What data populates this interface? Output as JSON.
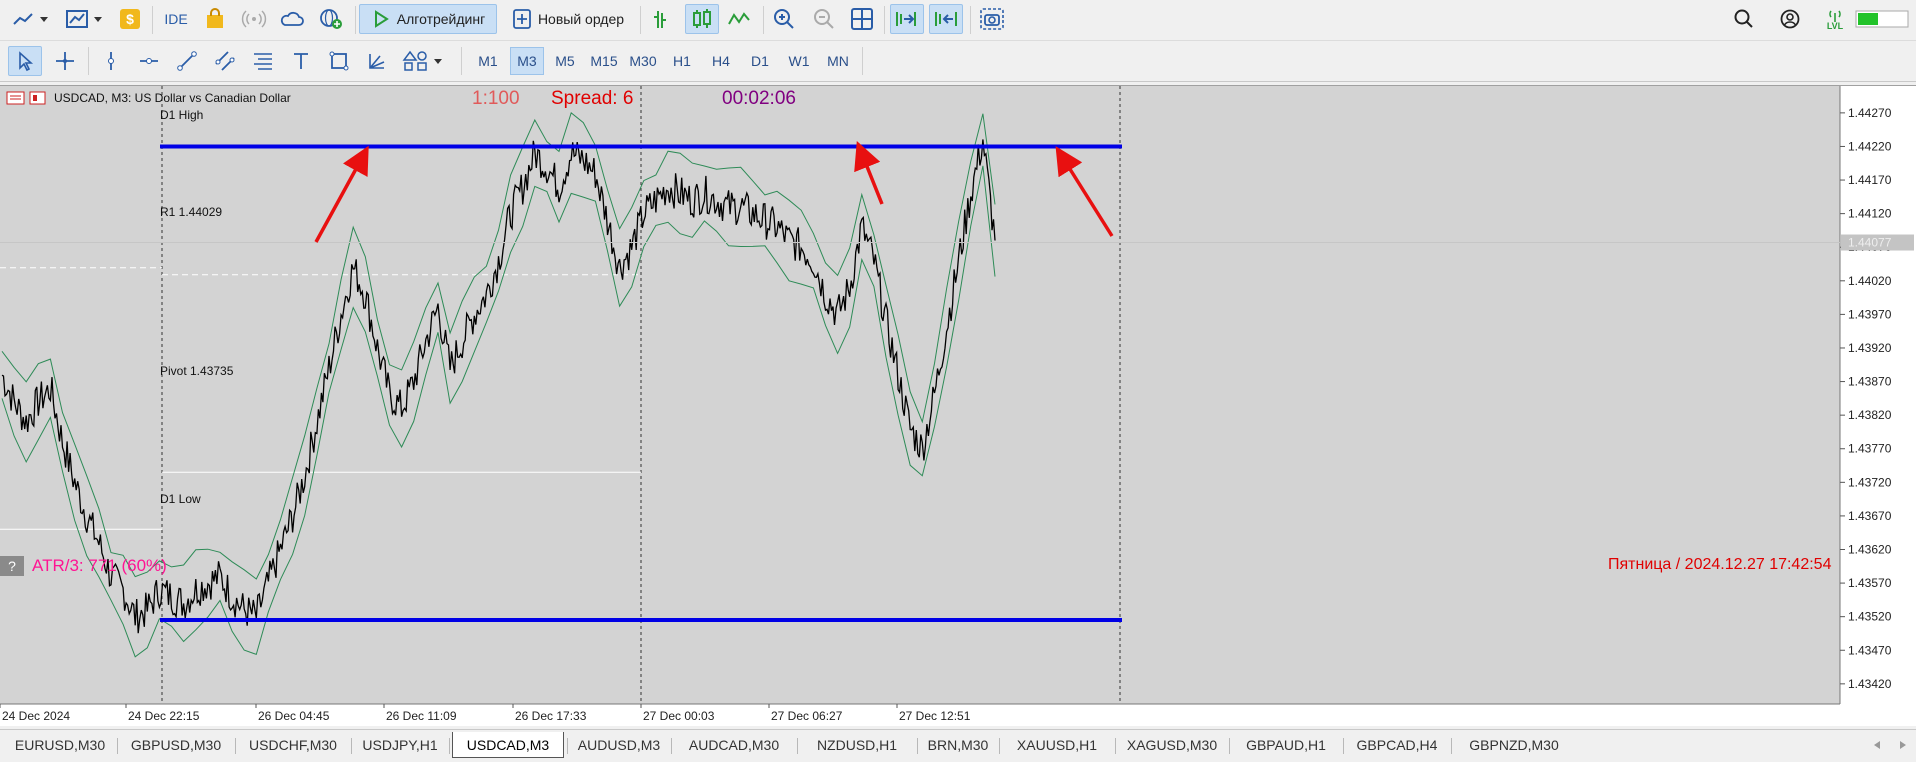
{
  "toolbar_top": {
    "ide_label": "IDE",
    "algo_label": "Алготрейдинг",
    "new_order_label": "Новый ордер",
    "lvl_label": "LVL"
  },
  "timeframes": [
    "M1",
    "M3",
    "M5",
    "M15",
    "M30",
    "H1",
    "H4",
    "D1",
    "W1",
    "MN"
  ],
  "active_timeframe": "M3",
  "chart": {
    "symbol_caption": "USDCAD, M3:  US Dollar vs Canadian Dollar",
    "leverage": "1:100",
    "spread": "Spread: 6",
    "timer": "00:02:06",
    "atr": "ATR/3: 771 (60%)",
    "datetime": "Пятница / 2024.12.27 17:42:54",
    "help": "?",
    "levels": {
      "d1_high": "D1 High",
      "r1": "R1 1.44029",
      "pivot": "Pivot 1.43735",
      "d1_low": "D1 Low"
    },
    "current_price": "1.44077",
    "price_ticks": [
      "1.44270",
      "1.44220",
      "1.44170",
      "1.44120",
      "1.44070",
      "1.44020",
      "1.43970",
      "1.43920",
      "1.43870",
      "1.43820",
      "1.43770",
      "1.43720",
      "1.43670",
      "1.43620",
      "1.43570",
      "1.43520",
      "1.43470",
      "1.43420"
    ],
    "time_ticks": [
      "24 Dec 2024",
      "24 Dec 22:15",
      "26 Dec 04:45",
      "26 Dec 11:09",
      "26 Dec 17:33",
      "27 Dec 00:03",
      "27 Dec 06:27",
      "27 Dec 12:51"
    ],
    "colors": {
      "level_line": "#0000e6",
      "arrow": "#e81010",
      "price_line": "#000000",
      "band": "#2e8b57",
      "leverage": "#e05a5a",
      "spread": "#e00000",
      "timer": "#800080",
      "atr": "#ff1493",
      "datetime": "#e00000"
    }
  },
  "chart_data": {
    "type": "line",
    "series": [
      {
        "values": [
          1.4388,
          1.4384,
          1.4381,
          1.4384,
          1.4386,
          1.4378,
          1.4372,
          1.4367,
          1.4363,
          1.4358,
          1.4356,
          1.4352,
          1.4353,
          1.4356,
          1.4355,
          1.4354,
          1.4356,
          1.4357,
          1.4358,
          1.4355,
          1.4353,
          1.4352,
          1.4357,
          1.4362,
          1.4367,
          1.4373,
          1.4381,
          1.4389,
          1.4397,
          1.4404,
          1.44,
          1.4392,
          1.4385,
          1.4383,
          1.4387,
          1.4393,
          1.4398,
          1.4389,
          1.4393,
          1.4397,
          1.44,
          1.4405,
          1.4412,
          1.4416,
          1.4421,
          1.4419,
          1.4416,
          1.4421,
          1.442,
          1.4418,
          1.4411,
          1.4404,
          1.4407,
          1.4412,
          1.4414,
          1.4416,
          1.4415,
          1.4414,
          1.4415,
          1.4414,
          1.4413,
          1.4413,
          1.4412,
          1.4411,
          1.441,
          1.4408,
          1.4407,
          1.4405,
          1.44,
          1.4397,
          1.4401,
          1.441,
          1.4405,
          1.4396,
          1.4388,
          1.438,
          1.4377,
          1.4385,
          1.4395,
          1.4405,
          1.4415,
          1.4423,
          1.4408
        ]
      }
    ],
    "x_range": [
      "24 Dec 2024",
      "27 Dec 17:42"
    ],
    "ylim": [
      1.4339,
      1.4431
    ],
    "levels": {
      "d1_high": 1.4422,
      "r1": 1.44029,
      "pivot": 1.43735,
      "d1_low": 1.43515
    },
    "grid": false
  },
  "tabs": [
    "EURUSD,M30",
    "GBPUSD,M30",
    "USDCHF,M30",
    "USDJPY,H1",
    "USDCAD,M3",
    "AUDUSD,M3",
    "AUDCAD,M30",
    "NZDUSD,H1",
    "BRN,M30",
    "XAUUSD,H1",
    "XAGUSD,M30",
    "GBPAUD,H1",
    "GBPCAD,H4",
    "GBPNZD,M30"
  ],
  "active_tab": "USDCAD,M3"
}
